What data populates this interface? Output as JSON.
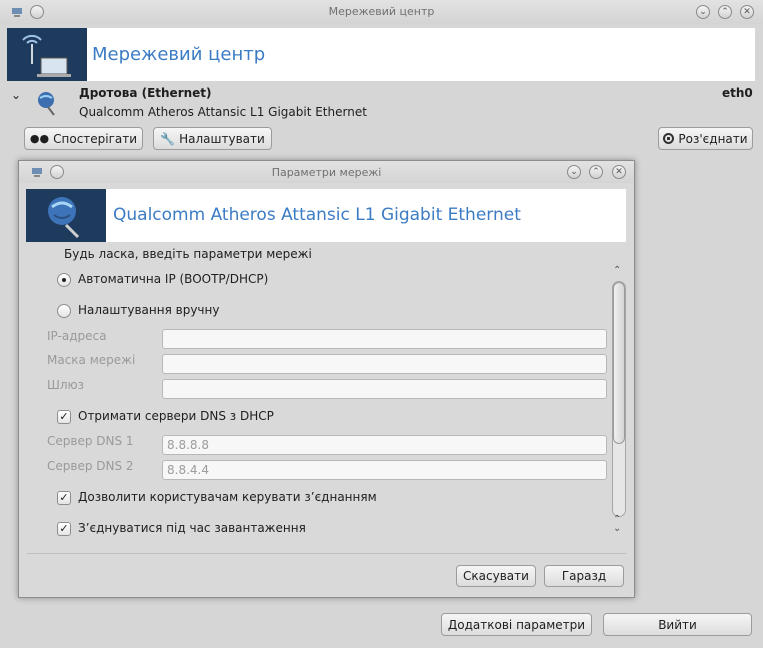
{
  "window": {
    "title": "Мережевий центр"
  },
  "header": {
    "title": "Мережевий центр"
  },
  "connection": {
    "type": "Дротова (Ethernet)",
    "device": "Qualcomm Atheros Attansic L1 Gigabit Ethernet",
    "interface": "eth0"
  },
  "actions": {
    "monitor": "Спостерігати",
    "configure": "Налаштувати",
    "disconnect": "Роз'єднати"
  },
  "dialog": {
    "title": "Параметри мережі",
    "banner": "Qualcomm Atheros Attansic L1 Gigabit Ethernet",
    "prompt": "Будь ласка, введіть параметри мережі",
    "radio_auto": "Автоматична IP (BOOTP/DHCP)",
    "radio_auto_selected": true,
    "radio_manual": "Налаштування вручну",
    "ip_label": "IP-адреса",
    "ip_value": "",
    "mask_label": "Маска мережі",
    "mask_value": "",
    "gateway_label": "Шлюз",
    "gateway_value": "",
    "dns_dhcp": "Отримати сервери DNS з DHCP",
    "dns_dhcp_checked": true,
    "dns1_label": "Сервер DNS 1",
    "dns1_value": "8.8.8.8",
    "dns2_label": "Сервер DNS 2",
    "dns2_value": "8.8.4.4",
    "allow_users": "Дозволити користувачам керувати з’єднанням",
    "allow_users_checked": true,
    "connect_boot": "З’єднуватися під час завантаження",
    "connect_boot_checked": true,
    "cancel": "Скасувати",
    "ok": "Гаразд"
  },
  "footer": {
    "advanced": "Додаткові параметри",
    "quit": "Вийти"
  },
  "colors": {
    "accent": "#3b7cc4",
    "banner_bg": "#1e3a5c"
  },
  "icons": [
    "network-icon",
    "ethernet-icon",
    "binoculars-icon",
    "wrench-icon",
    "stop-icon",
    "minimize-icon",
    "maximize-icon",
    "close-icon",
    "chevron-down-icon"
  ]
}
